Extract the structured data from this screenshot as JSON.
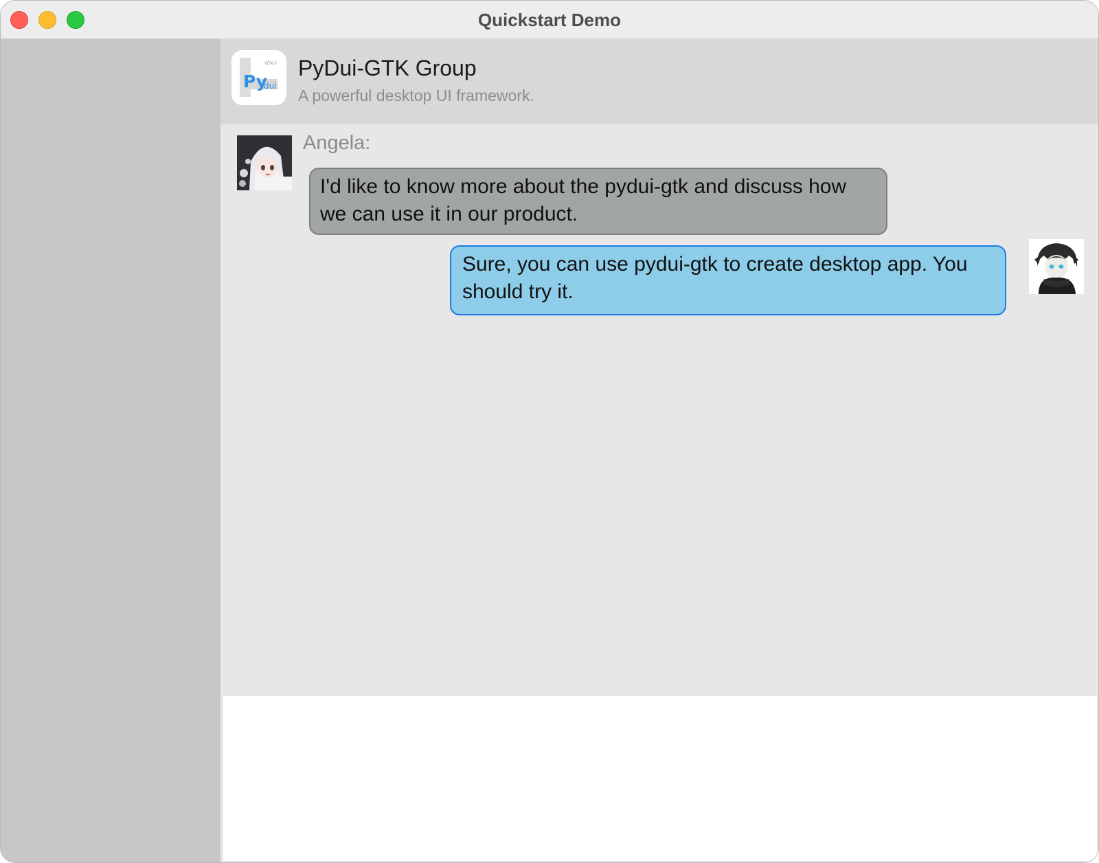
{
  "window": {
    "title": "Quickstart Demo"
  },
  "chat": {
    "group_name": "PyDui-GTK Group",
    "group_description": "A powerful desktop UI framework.",
    "logo": {
      "badge": "GTK-3",
      "main": "Py",
      "sub": "dui"
    }
  },
  "messages": [
    {
      "sender": "Angela:",
      "text": "I'd like to know more about the pydui-gtk and discuss how we can use it in our product.",
      "side": "left"
    },
    {
      "text": "Sure, you can use pydui-gtk to create desktop app. You should try it.",
      "side": "right"
    }
  ],
  "input": {
    "value": ""
  },
  "colors": {
    "incoming_bubble": "#a2a5a6",
    "outgoing_bubble": "#8ecdea",
    "outgoing_border": "#1d7de0",
    "logo_blue": "#2f8fe6"
  }
}
